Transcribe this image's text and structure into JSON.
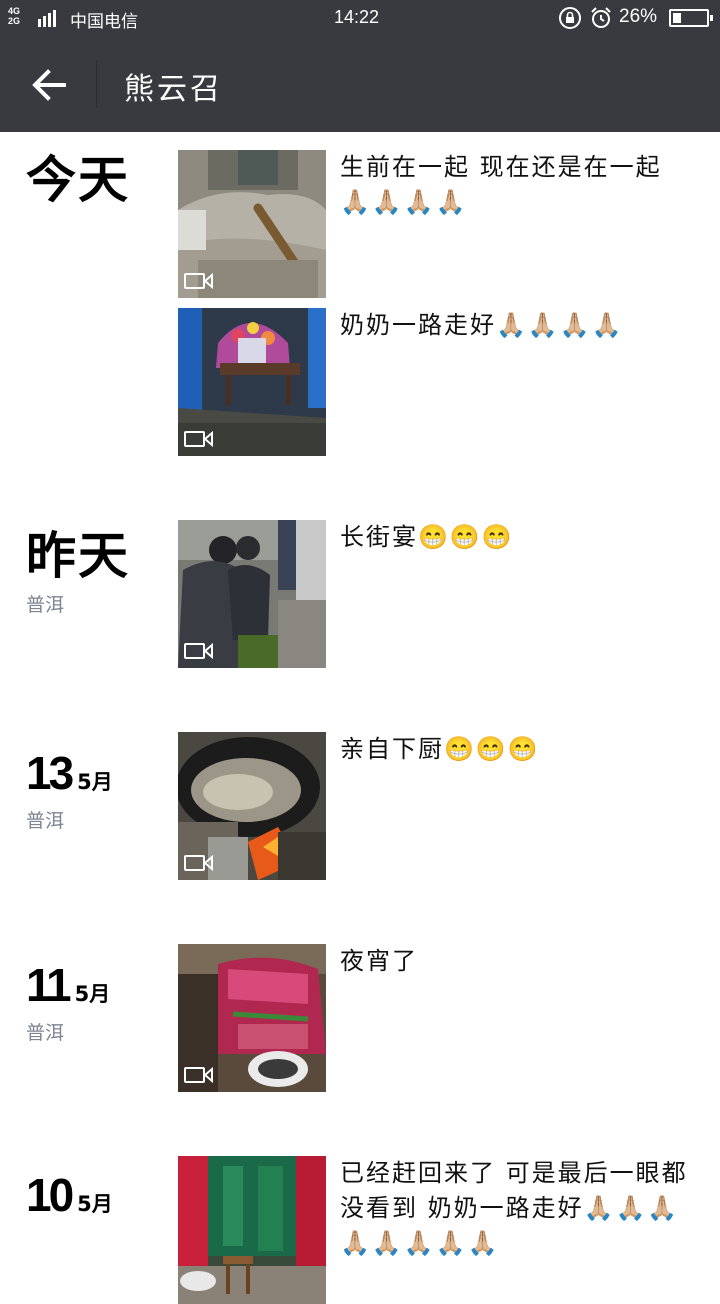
{
  "status": {
    "network_top": "4G",
    "network_bottom": "2G",
    "carrier": "中国电信",
    "time": "14:22",
    "battery_percent": "26%",
    "battery_level": 0.26
  },
  "header": {
    "title": "熊云召",
    "back_icon": "arrow-left-icon"
  },
  "days": [
    {
      "date_text": "今天",
      "location": "",
      "entries": [
        {
          "caption": "生前在一起 现在还是在一起 🙏🏼🙏🏼🙏🏼🙏🏼",
          "media": "video"
        },
        {
          "caption": "奶奶一路走好🙏🏼🙏🏼🙏🏼🙏🏼",
          "media": "video"
        }
      ]
    },
    {
      "date_text": "昨天",
      "location": "普洱",
      "entries": [
        {
          "caption": "长街宴😁😁😁",
          "media": "video"
        }
      ]
    },
    {
      "day": "13",
      "month": "5月",
      "location": "普洱",
      "entries": [
        {
          "caption": "亲自下厨😁😁😁",
          "media": "video"
        }
      ]
    },
    {
      "day": "11",
      "month": "5月",
      "location": "普洱",
      "entries": [
        {
          "caption": "夜宵了",
          "media": "video"
        }
      ]
    },
    {
      "day": "10",
      "month": "5月",
      "location": "",
      "entries": [
        {
          "caption": "已经赶回来了 可是最后一眼都没看到 奶奶一路走好🙏🏼🙏🏼🙏🏼🙏🏼🙏🏼🙏🏼🙏🏼🙏🏼",
          "media": "video"
        }
      ]
    }
  ]
}
